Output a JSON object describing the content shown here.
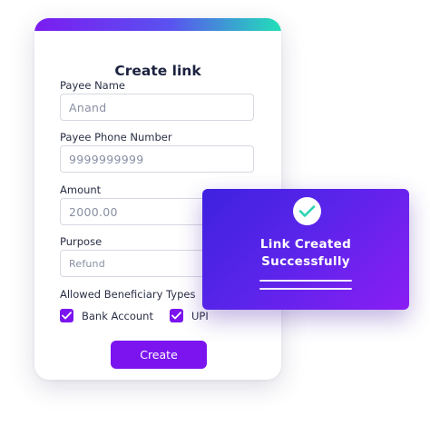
{
  "form": {
    "title": "Create link",
    "payee_name": {
      "label": "Payee Name",
      "placeholder": "Anand"
    },
    "payee_phone": {
      "label": "Payee Phone Number",
      "placeholder": "9999999999"
    },
    "amount": {
      "label": "Amount",
      "placeholder": "2000.00"
    },
    "purpose": {
      "label": "Purpose",
      "placeholder": "Refund"
    },
    "beneficiary": {
      "label": "Allowed Beneficiary Types",
      "options": [
        {
          "label": "Bank Account",
          "checked": true
        },
        {
          "label": "UPI",
          "checked": true
        }
      ]
    },
    "create_label": "Create"
  },
  "toast": {
    "line1": "Link Created",
    "line2": "Successfully"
  },
  "colors": {
    "accent": "#7b14ef",
    "gradient_start": "#7b1cf0",
    "gradient_end": "#22e0b8",
    "toast_start": "#3e22e0",
    "toast_end": "#8a1ef4",
    "success": "#2bd4b0"
  },
  "icons": {
    "checkbox": "checkmark-icon",
    "toast": "success-check-icon"
  }
}
